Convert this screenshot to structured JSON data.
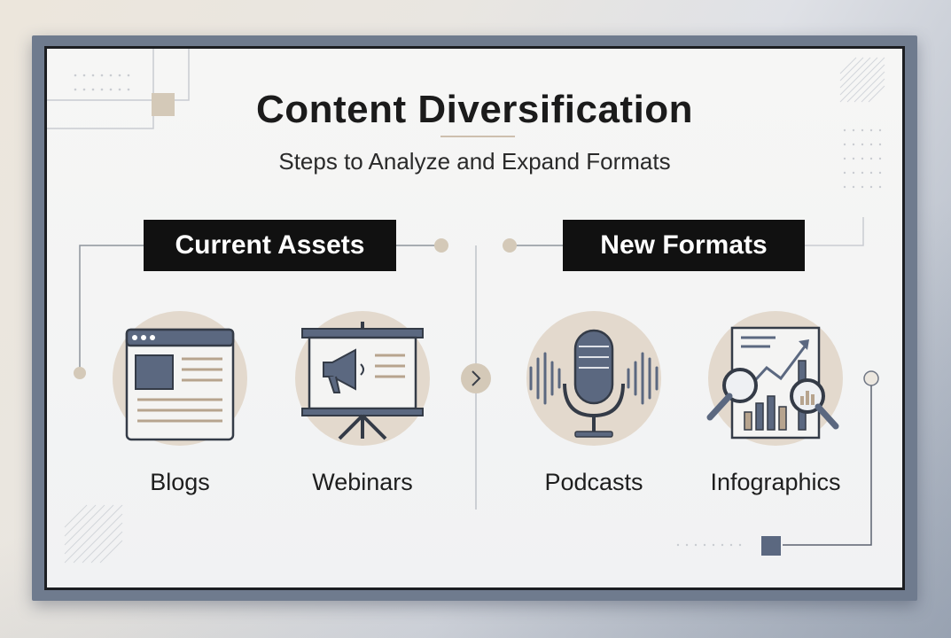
{
  "title": "Content Diversification",
  "subtitle": "Steps to Analyze and Expand Formats",
  "sections": {
    "left": {
      "label": "Current Assets"
    },
    "right": {
      "label": "New Formats"
    }
  },
  "items": {
    "blogs": {
      "label": "Blogs",
      "icon": "browser-page-icon"
    },
    "webinars": {
      "label": "Webinars",
      "icon": "presentation-megaphone-icon"
    },
    "podcasts": {
      "label": "Podcasts",
      "icon": "microphone-icon"
    },
    "infographics": {
      "label": "Infographics",
      "icon": "chart-magnifier-icon"
    }
  },
  "colors": {
    "accent_beige": "#e3d9cd",
    "slate": "#5b6880",
    "ink": "#111111",
    "frame": "#6f7b8e"
  }
}
